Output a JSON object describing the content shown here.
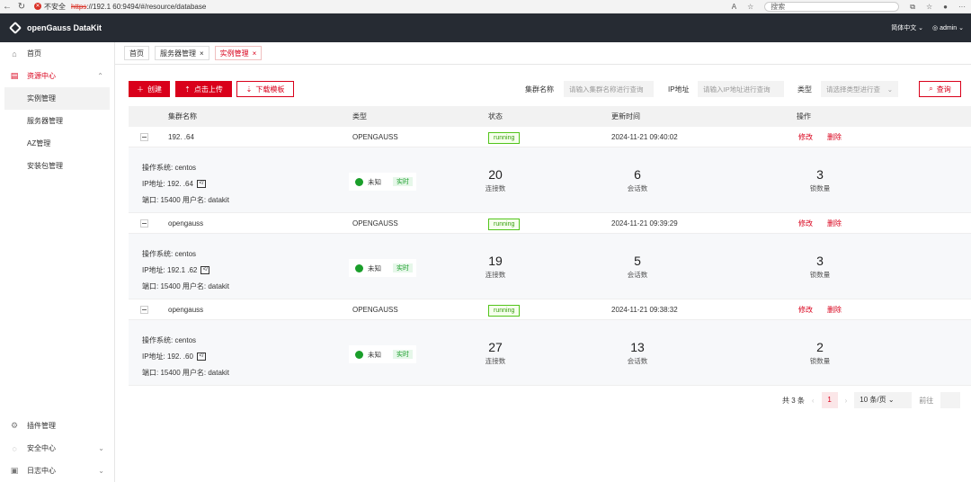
{
  "browser": {
    "security_label": "不安全",
    "url_protocol": "https",
    "url_rest": "://192.1        60:9494/#/resource/database",
    "search_placeholder": "搜索"
  },
  "app": {
    "title": "openGauss DataKit",
    "language": "简体中文",
    "user": "admin"
  },
  "sidebar": {
    "home": "首页",
    "resource_center": "资源中心",
    "sub_items": [
      "实例管理",
      "服务器管理",
      "AZ管理",
      "安装包管理"
    ],
    "plugin": "插件管理",
    "security": "安全中心",
    "log": "日志中心"
  },
  "tabs": [
    "首页",
    "服务器管理",
    "实例管理"
  ],
  "toolbar": {
    "create": "创建",
    "upload": "点击上传",
    "download": "下载模板",
    "cluster_label": "集群名称",
    "cluster_placeholder": "请输入集群名称进行查询",
    "ip_label": "IP地址",
    "ip_placeholder": "请输入IP地址进行查询",
    "type_label": "类型",
    "type_placeholder": "请选择类型进行查询",
    "query": "查询"
  },
  "table": {
    "headers": [
      "集群名称",
      "类型",
      "状态",
      "更新时间",
      "操作"
    ],
    "rows": [
      {
        "name": "192.          .64",
        "type": "OPENGAUSS",
        "status": "running",
        "updated": "2024-11-21 09:40:02",
        "edit": "修改",
        "delete": "删除",
        "os": "操作系统:  centos",
        "ip": "IP地址: 192.          .64",
        "port": "端口: 15400  用户名: datakit",
        "health": "未知",
        "realtime": "实时",
        "connections": "20",
        "sessions": "6",
        "locks": "3"
      },
      {
        "name": "opengauss",
        "type": "OPENGAUSS",
        "status": "running",
        "updated": "2024-11-21 09:39:29",
        "edit": "修改",
        "delete": "删除",
        "os": "操作系统:  centos",
        "ip": "IP地址: 192.1          .62",
        "port": "端口: 15400  用户名: datakit",
        "health": "未知",
        "realtime": "实时",
        "connections": "19",
        "sessions": "5",
        "locks": "3"
      },
      {
        "name": "opengauss",
        "type": "OPENGAUSS",
        "status": "running",
        "updated": "2024-11-21 09:38:32",
        "edit": "修改",
        "delete": "删除",
        "os": "操作系统:  centos",
        "ip": "IP地址: 192.          .60",
        "port": "端口: 15400  用户名: datakit",
        "health": "未知",
        "realtime": "实时",
        "connections": "27",
        "sessions": "13",
        "locks": "2"
      }
    ],
    "metric_labels": {
      "connections": "连接数",
      "sessions": "会话数",
      "locks": "锁数量"
    }
  },
  "pagination": {
    "total": "共 3 条",
    "page": "1",
    "page_size": "10 条/页",
    "goto": "前往"
  },
  "colors": {
    "accent": "#d9001b",
    "topbar": "#262b33",
    "running": "#52c41a"
  }
}
